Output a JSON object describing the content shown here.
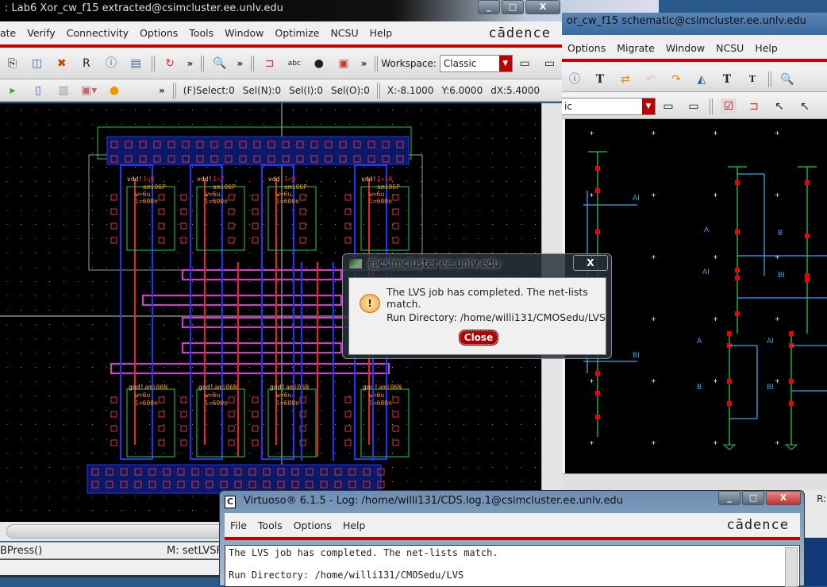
{
  "left_window": {
    "title": ": Lab6 Xor_cw_f15 extracted@csimcluster.ee.unlv.edu",
    "menu": [
      "ate",
      "Verify",
      "Connectivity",
      "Options",
      "Tools",
      "Window",
      "Optimize",
      "NCSU",
      "Help"
    ],
    "brand": "cādence",
    "workspace_label": "Workspace:",
    "workspace_value": "Classic",
    "status": {
      "select": "(F)Select:0",
      "sel_n": "Sel(N):0",
      "sel_i": "Sel(I):0",
      "sel_o": "Sel(O):0",
      "x": "X:-8.1000",
      "y": "Y:6.0000",
      "dx": "dX:5.4000"
    },
    "more": "»",
    "cmd_left": "BPress()",
    "cmd_right": "M: setLVSF",
    "layout_labels": {
      "vdd": "vdd!",
      "gnd": "gnd!",
      "w": "w=6u",
      "l": "l=600n",
      "pmos": "ami06P",
      "nmos": "ami06N",
      "inst": [
        "I=8",
        "I=7",
        "I=9",
        "I=10"
      ]
    }
  },
  "right_window": {
    "title": "or_cw_f15 schematic@csimcluster.ee.unlv.edu",
    "menu": [
      "Options",
      "Migrate",
      "Window",
      "NCSU",
      "Help"
    ],
    "workspace_value": "ic",
    "labels": [
      "AI",
      "BI",
      "A",
      "AI",
      "B",
      "BI",
      "A",
      "AI",
      "B",
      "BI"
    ]
  },
  "dialog": {
    "title": "@csimcluster.ee.unlv.edu",
    "message": "The LVS job has completed. The net-lists match.",
    "run_dir": "Run Directory: /home/willi131/CMOSedu/LVS",
    "close": "Close",
    "x": "X"
  },
  "log_window": {
    "title": "Virtuoso® 6.1.5 - Log: /home/willi131/CDS.log.1@csimcluster.ee.unlv.edu",
    "menu": [
      "File",
      "Tools",
      "Options",
      "Help"
    ],
    "brand": "cādence",
    "lines": [
      "The LVS job has completed. The net-lists match.",
      "",
      "Run Directory: /home/willi131/CMOSedu/LVS"
    ],
    "side": "R:"
  },
  "colors": {
    "menu_accent": "#c80000",
    "close_button": "#b00000",
    "canvas": "#000000"
  }
}
